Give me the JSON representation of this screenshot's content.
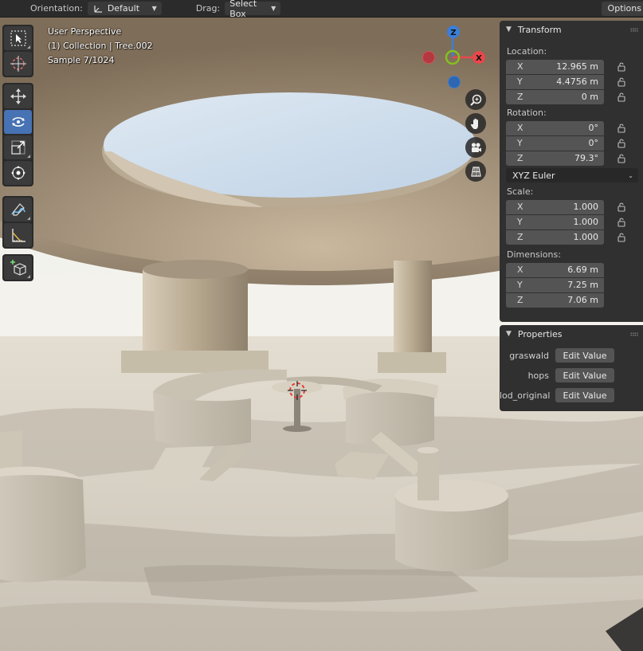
{
  "header": {
    "orientation_label": "Orientation:",
    "orientation_value": "Default",
    "drag_label": "Drag:",
    "drag_value": "Select Box",
    "options_label": "Options"
  },
  "viewport": {
    "view_name": "User Perspective",
    "collection": "(1) Collection | Tree.002",
    "sample": "Sample 7/1024"
  },
  "toolbar": {
    "tools": [
      {
        "name": "select-box",
        "icon": "select-box-icon",
        "active": false
      },
      {
        "name": "cursor",
        "icon": "cursor-icon",
        "active": false
      },
      {
        "name": "move",
        "icon": "move-icon",
        "active": false
      },
      {
        "name": "rotate",
        "icon": "rotate-icon",
        "active": true
      },
      {
        "name": "scale",
        "icon": "scale-icon",
        "active": false
      },
      {
        "name": "transform",
        "icon": "transform-icon",
        "active": false
      },
      {
        "name": "annotate",
        "icon": "annotate-icon",
        "active": false
      },
      {
        "name": "measure",
        "icon": "measure-icon",
        "active": false
      },
      {
        "name": "add-cube",
        "icon": "add-cube-icon",
        "active": false
      }
    ]
  },
  "gizmo": {
    "z_label": "Z",
    "x_label": "X",
    "colors": {
      "x": "#e8474b",
      "y": "#84c01f",
      "z": "#3a7fd9"
    }
  },
  "nav_icons": [
    "zoom-icon",
    "hand-icon",
    "camera-icon",
    "grid-icon"
  ],
  "transform": {
    "title": "Transform",
    "location_label": "Location:",
    "location": [
      {
        "axis": "X",
        "value": "12.965 m"
      },
      {
        "axis": "Y",
        "value": "4.4756 m"
      },
      {
        "axis": "Z",
        "value": "0 m"
      }
    ],
    "rotation_label": "Rotation:",
    "rotation": [
      {
        "axis": "X",
        "value": "0°"
      },
      {
        "axis": "Y",
        "value": "0°"
      },
      {
        "axis": "Z",
        "value": "79.3°"
      }
    ],
    "rotation_mode": "XYZ Euler",
    "scale_label": "Scale:",
    "scale": [
      {
        "axis": "X",
        "value": "1.000"
      },
      {
        "axis": "Y",
        "value": "1.000"
      },
      {
        "axis": "Z",
        "value": "1.000"
      }
    ],
    "dimensions_label": "Dimensions:",
    "dimensions": [
      {
        "axis": "X",
        "value": "6.69 m"
      },
      {
        "axis": "Y",
        "value": "7.25 m"
      },
      {
        "axis": "Z",
        "value": "7.06 m"
      }
    ]
  },
  "properties": {
    "title": "Properties",
    "items": [
      {
        "name": "graswald",
        "button": "Edit Value"
      },
      {
        "name": "hops",
        "button": "Edit Value"
      },
      {
        "name": "lod_original",
        "button": "Edit Value"
      }
    ]
  },
  "colors": {
    "accent": "#4772b3",
    "panel_bg": "#303030",
    "field_bg": "#545454"
  }
}
